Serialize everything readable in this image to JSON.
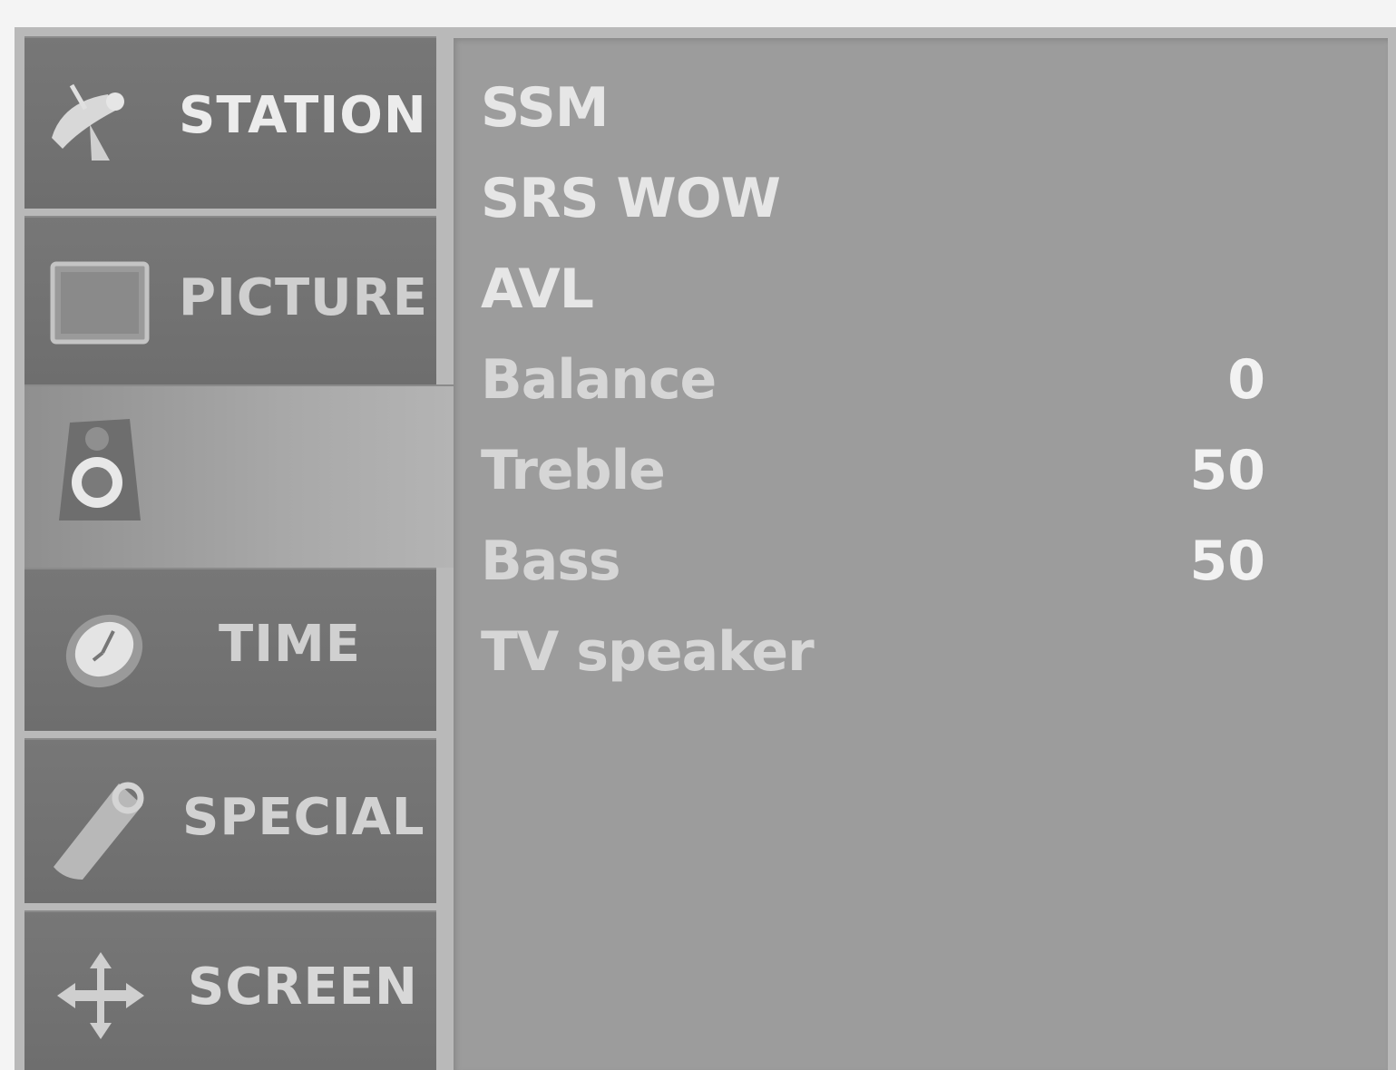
{
  "menu": {
    "tabs": [
      {
        "id": "station",
        "label": "STATION",
        "icon": "satellite-dish-icon"
      },
      {
        "id": "picture",
        "label": "PICTURE",
        "icon": "tv-screen-icon"
      },
      {
        "id": "sound",
        "label": "",
        "icon": "speaker-icon",
        "active": true
      },
      {
        "id": "time",
        "label": "TIME",
        "icon": "clock-icon"
      },
      {
        "id": "special",
        "label": "SPECIAL",
        "icon": "tag-icon"
      },
      {
        "id": "screen",
        "label": "SCREEN",
        "icon": "move-arrows-icon"
      }
    ]
  },
  "sound": {
    "items": [
      {
        "label": "SSM",
        "value": ""
      },
      {
        "label": "SRS WOW",
        "value": ""
      },
      {
        "label": "AVL",
        "value": ""
      },
      {
        "label": "Balance",
        "value": "0"
      },
      {
        "label": "Treble",
        "value": "50"
      },
      {
        "label": "Bass",
        "value": "50"
      },
      {
        "label": "TV speaker",
        "value": ""
      }
    ]
  },
  "colors": {
    "tab_bg": "#707070",
    "panel_bg": "#9c9c9c",
    "text_light": "#e6e6e6"
  }
}
